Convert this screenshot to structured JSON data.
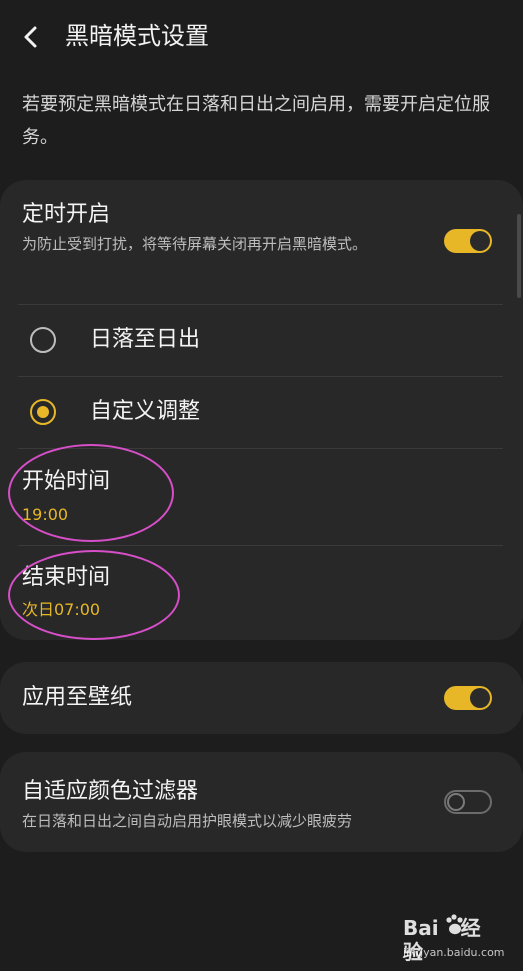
{
  "header": {
    "title": "黑暗模式设置",
    "back_icon": "back-chevron-icon"
  },
  "intro_text": "若要预定黑暗模式在日落和日出之间启用，需要开启定位服务。",
  "schedule": {
    "title": "定时开启",
    "description": "为防止受到打扰，将等待屏幕关闭再开启黑暗模式。",
    "enabled": true,
    "options": [
      {
        "label": "日落至日出",
        "selected": false
      },
      {
        "label": "自定义调整",
        "selected": true
      }
    ],
    "start": {
      "label": "开始时间",
      "value": "19:00"
    },
    "end": {
      "label": "结束时间",
      "value": "次日07:00"
    }
  },
  "wallpaper": {
    "label": "应用至壁纸",
    "enabled": true
  },
  "adaptive_filter": {
    "title": "自适应颜色过滤器",
    "description": "在日落和日出之间自动启用护眼模式以减少眼疲劳",
    "enabled": false
  },
  "watermark": {
    "brand": "Bai",
    "brand_suffix": "经验",
    "site": "jingyan.baidu.com"
  },
  "colors": {
    "background": "#1d1d1d",
    "card": "#282828",
    "accent": "#e7b728",
    "annotation": "#d64fc9"
  }
}
